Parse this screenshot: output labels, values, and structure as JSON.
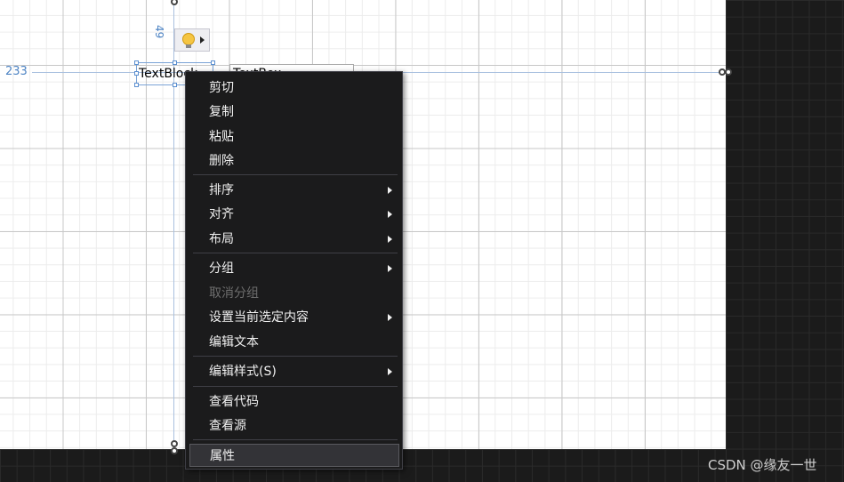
{
  "designer": {
    "margin_left_value": "233",
    "margin_top_value": "49",
    "selected_element_text": "TextBlock",
    "neighbor_element_text": "TextBox"
  },
  "context_menu": {
    "items": [
      {
        "label": "剪切",
        "submenu": false,
        "enabled": true
      },
      {
        "label": "复制",
        "submenu": false,
        "enabled": true
      },
      {
        "label": "粘贴",
        "submenu": false,
        "enabled": true
      },
      {
        "label": "删除",
        "submenu": false,
        "enabled": true
      },
      {
        "label": "排序",
        "submenu": true,
        "enabled": true
      },
      {
        "label": "对齐",
        "submenu": true,
        "enabled": true
      },
      {
        "label": "布局",
        "submenu": true,
        "enabled": true
      },
      {
        "label": "分组",
        "submenu": true,
        "enabled": true
      },
      {
        "label": "取消分组",
        "submenu": false,
        "enabled": false
      },
      {
        "label": "设置当前选定内容",
        "submenu": true,
        "enabled": true
      },
      {
        "label": "编辑文本",
        "submenu": false,
        "enabled": true
      },
      {
        "label": "编辑样式(S)",
        "submenu": true,
        "enabled": true
      },
      {
        "label": "查看代码",
        "submenu": false,
        "enabled": true
      },
      {
        "label": "查看源",
        "submenu": false,
        "enabled": true
      },
      {
        "label": "属性",
        "submenu": false,
        "enabled": true,
        "hovered": true
      }
    ]
  },
  "watermark": "CSDN @缘友一世",
  "colors": {
    "menu_bg": "#1b1b1c",
    "menu_text": "#f1f1f1",
    "disabled_text": "#6d6d6d",
    "selection_blue": "#7aa3d6"
  },
  "icons": {
    "quick_action": "lightbulb-icon",
    "submenu": "chevron-right-icon"
  }
}
